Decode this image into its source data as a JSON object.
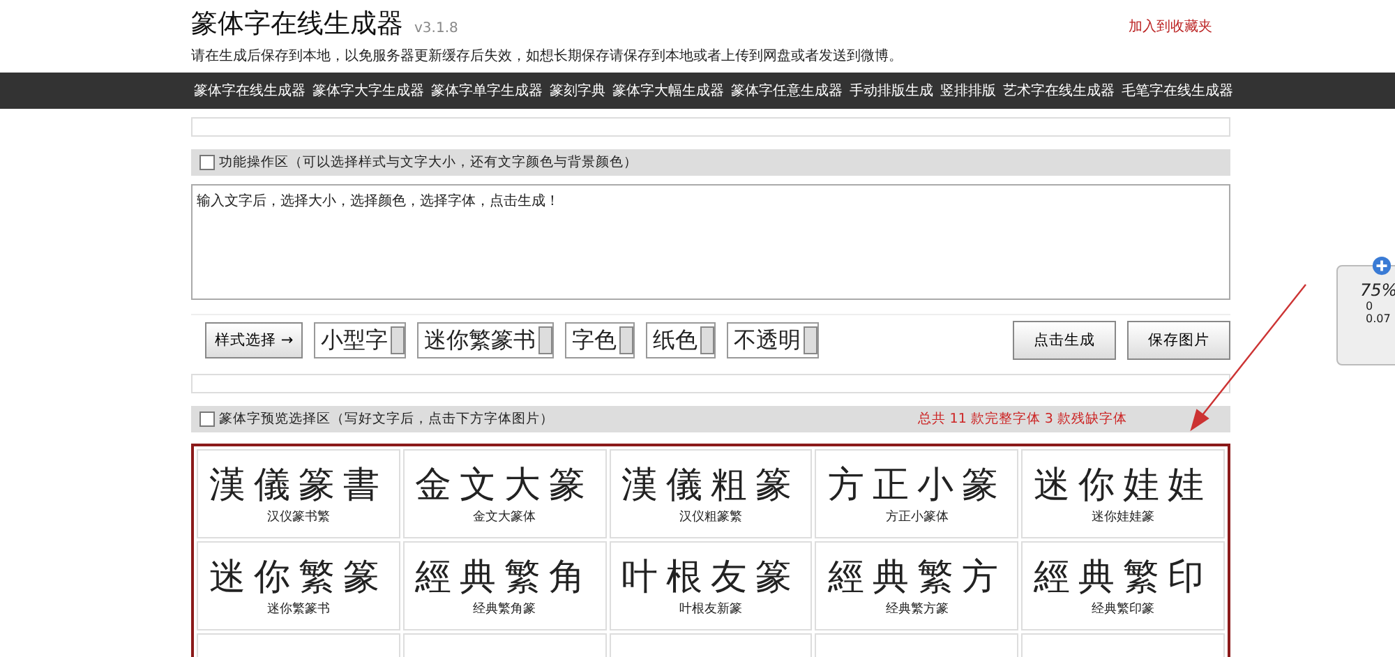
{
  "header": {
    "title": "篆体字在线生成器",
    "version": "v3.1.8",
    "notice": "请在生成后保存到本地，以免服务器更新缓存后失效，如想长期保存请保存到本地或者上传到网盘或者发送到微博。",
    "bookmark_link": "加入到收藏夹"
  },
  "nav": [
    "篆体字在线生成器",
    "篆体字大字生成器",
    "篆体字单字生成器",
    "篆刻字典",
    "篆体字大幅生成器",
    "篆体字任意生成器",
    "手动排版生成",
    "竖排排版",
    "艺术字在线生成器",
    "毛笔字在线生成器"
  ],
  "function_panel": {
    "header": "功能操作区（可以选择样式与文字大小，还有文字颜色与背景颜色）",
    "text_value": "输入文字后，选择大小，选择颜色，选择字体，点击生成！"
  },
  "controls": [
    {
      "kind": "button",
      "label": "样式选择 →"
    },
    {
      "kind": "select",
      "value": "小型字"
    },
    {
      "kind": "select",
      "value": "迷你繁篆书"
    },
    {
      "kind": "select",
      "value": "字色"
    },
    {
      "kind": "select",
      "value": "纸色"
    },
    {
      "kind": "select",
      "value": "不透明"
    }
  ],
  "actions": [
    "点击生成",
    "保存图片"
  ],
  "preview_panel": {
    "header": "篆体字预览选择区（写好文字后，点击下方字体图片）",
    "summary": "总共 11 款完整字体 3 款残缺字体"
  },
  "fonts": [
    {
      "sample": "漢儀篆書",
      "name": "汉仪篆书繁"
    },
    {
      "sample": "金文大篆",
      "name": "金文大篆体"
    },
    {
      "sample": "漢儀粗篆",
      "name": "汉仪粗篆繁"
    },
    {
      "sample": "方正小篆",
      "name": "方正小篆体"
    },
    {
      "sample": "迷你娃娃",
      "name": "迷你娃娃篆"
    },
    {
      "sample": "迷你繁篆",
      "name": "迷你繁篆书"
    },
    {
      "sample": "經典繁角",
      "name": "经典繁角篆"
    },
    {
      "sample": "叶根友篆",
      "name": "叶根友新篆"
    },
    {
      "sample": "經典繁方",
      "name": "经典繁方篆"
    },
    {
      "sample": "經典繁印",
      "name": "经典繁印篆"
    }
  ],
  "widget": {
    "zoom": "75%",
    "readings": [
      "0",
      "0.07"
    ]
  }
}
